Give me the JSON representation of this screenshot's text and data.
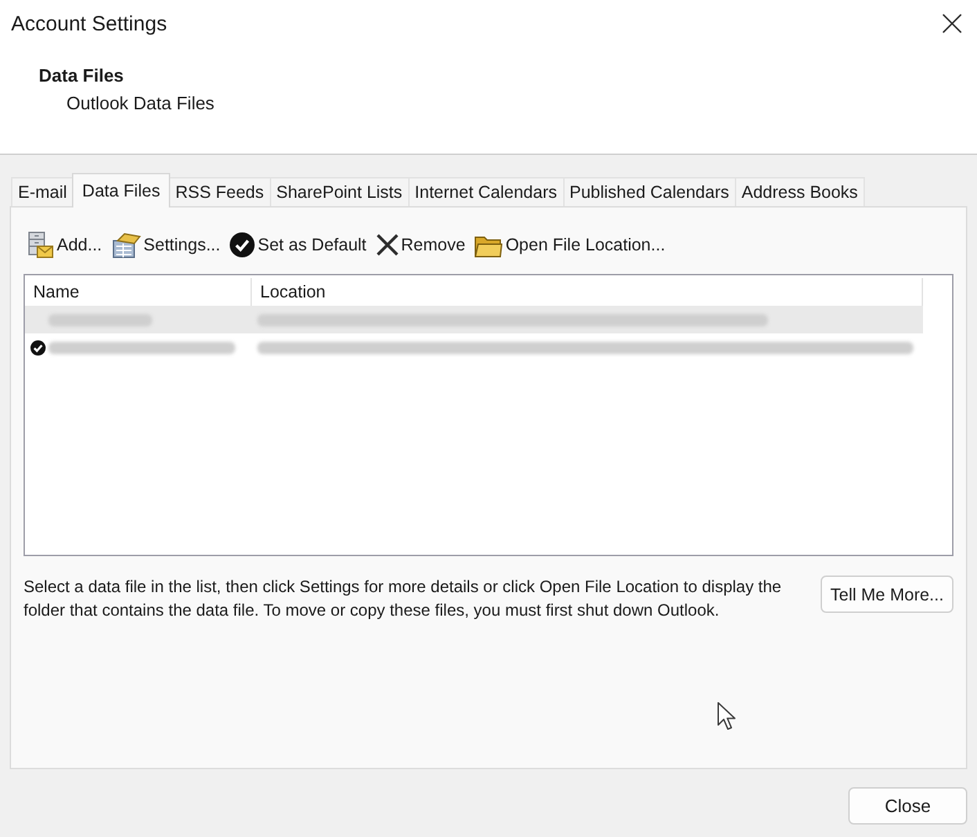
{
  "window": {
    "title": "Account Settings"
  },
  "header": {
    "title": "Data Files",
    "subtitle": "Outlook Data Files"
  },
  "tabs": [
    {
      "label": "E-mail",
      "selected": false
    },
    {
      "label": "Data Files",
      "selected": true
    },
    {
      "label": "RSS Feeds",
      "selected": false
    },
    {
      "label": "SharePoint Lists",
      "selected": false
    },
    {
      "label": "Internet Calendars",
      "selected": false
    },
    {
      "label": "Published Calendars",
      "selected": false
    },
    {
      "label": "Address Books",
      "selected": false
    }
  ],
  "toolbar": {
    "buttons": [
      {
        "label": "Add..."
      },
      {
        "label": "Settings..."
      },
      {
        "label": "Set as Default"
      },
      {
        "label": "Remove"
      },
      {
        "label": "Open File Location..."
      }
    ]
  },
  "list": {
    "columns": [
      "Name",
      "Location"
    ],
    "rows": [
      {
        "selected": true,
        "default": false
      },
      {
        "selected": false,
        "default": true
      }
    ]
  },
  "description": "Select a data file in the list, then click Settings for more details or click Open File Location to display the folder that contains the data file. To move or copy these files, you must first shut down Outlook.",
  "buttons": {
    "tell_me_more": "Tell Me More...",
    "close": "Close"
  }
}
